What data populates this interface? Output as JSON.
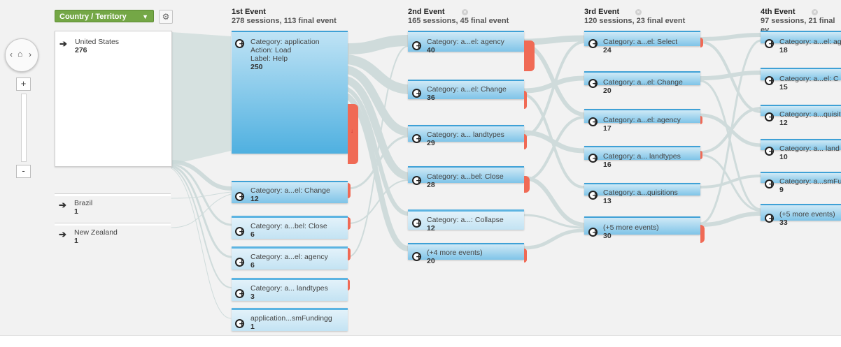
{
  "dimension_selector": {
    "label": "Country / Territory"
  },
  "zoom": {
    "plus": "+",
    "minus": "-"
  },
  "sources": [
    {
      "label": "United States",
      "count": "276"
    },
    {
      "label": "Brazil",
      "count": "1"
    },
    {
      "label": "New Zealand",
      "count": "1"
    }
  ],
  "columns": [
    {
      "title": "1st Event",
      "summary": "278 sessions, 113 final event"
    },
    {
      "title": "2nd Event",
      "summary": "165 sessions, 45 final event"
    },
    {
      "title": "3rd Event",
      "summary": "120 sessions, 23 final event"
    },
    {
      "title": "4th Event",
      "summary": "97 sessions, 21 final ev"
    }
  ],
  "col1_main": {
    "line1": "Category: application",
    "line2": "Action: Load",
    "line3": "Label: Help",
    "count": "250"
  },
  "col1_nodes": [
    {
      "label": "Category: a...el: Change",
      "count": "12"
    },
    {
      "label": "Category: a...bel: Close",
      "count": "6"
    },
    {
      "label": "Category: a...el: agency",
      "count": "6"
    },
    {
      "label": "Category: a... landtypes",
      "count": "3"
    },
    {
      "label": "application...smFundingg",
      "count": "1"
    }
  ],
  "col2_nodes": [
    {
      "label": "Category: a...el: agency",
      "count": "40"
    },
    {
      "label": "Category: a...el: Change",
      "count": "36"
    },
    {
      "label": "Category: a... landtypes",
      "count": "29"
    },
    {
      "label": "Category: a...bel: Close",
      "count": "28"
    },
    {
      "label": "Category: a...: Collapse",
      "count": "12"
    },
    {
      "label": "(+4 more events)",
      "count": "20"
    }
  ],
  "col3_nodes": [
    {
      "label": "Category: a...el: Select",
      "count": "24"
    },
    {
      "label": "Category: a...el: Change",
      "count": "20"
    },
    {
      "label": "Category: a...el: agency",
      "count": "17"
    },
    {
      "label": "Category: a... landtypes",
      "count": "16"
    },
    {
      "label": "Category: a...quisitions",
      "count": "13"
    },
    {
      "label": "(+5 more events)",
      "count": "30"
    }
  ],
  "col4_nodes": [
    {
      "label": "Category: a...el: ag",
      "count": "18"
    },
    {
      "label": "Category: a...el: C",
      "count": "15"
    },
    {
      "label": "Category: a...quisiti",
      "count": "12"
    },
    {
      "label": "Category: a... land",
      "count": "10"
    },
    {
      "label": "Category: a...smFu",
      "count": "9"
    },
    {
      "label": "(+5 more events)",
      "count": "33"
    }
  ],
  "icons": {
    "zoom_reset": "home-icon",
    "settings": "gear-icon",
    "remove_step": "close-icon",
    "event": "event-node-icon",
    "source": "arrow-right-icon",
    "exit": "exit-arrow-icon"
  },
  "colors": {
    "node": "#7fc4e8",
    "node_border": "#3fa1d6",
    "drop_off": "#f06a55",
    "flow": "#d3dfdf",
    "selector": "#74a746"
  }
}
